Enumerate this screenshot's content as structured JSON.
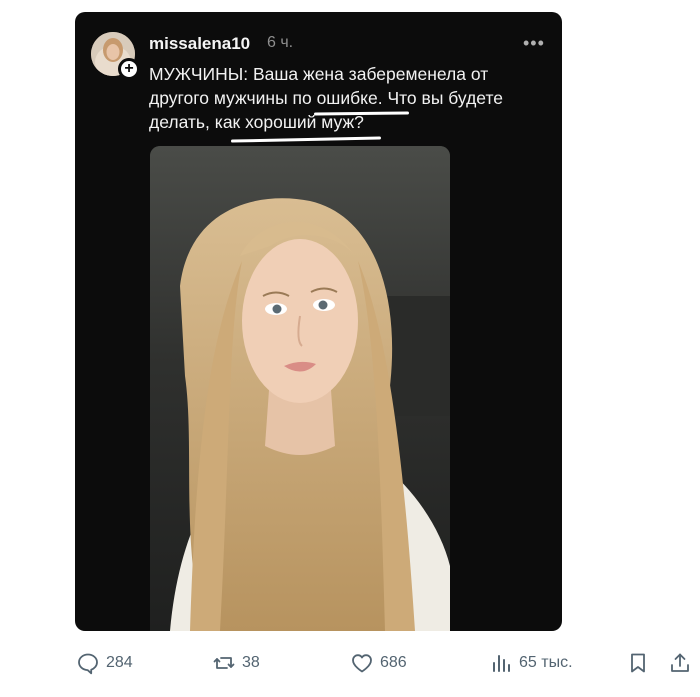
{
  "post": {
    "username": "missalena10",
    "time": "6 ч.",
    "text_lines": [
      "МУЖЧИНЫ: Ваша жена забеременела от",
      "другого мужчины по ошибке. Что вы будете",
      "делать, как хороший муж?"
    ],
    "photo_description": "selfie-photo",
    "follow_symbol": "+"
  },
  "actions": {
    "replies": "284",
    "reposts": "38",
    "likes": "686",
    "views": "65 тыс."
  },
  "icons": {
    "reply": "reply-bubble-icon",
    "repost": "repost-icon",
    "like": "heart-icon",
    "views": "views-bars-icon",
    "bookmark": "bookmark-icon",
    "share": "share-icon",
    "more": "more-dots-icon"
  },
  "colors": {
    "card_bg": "#0c0c0c",
    "action_gray": "#536471",
    "text_light": "#f2f2f2"
  }
}
